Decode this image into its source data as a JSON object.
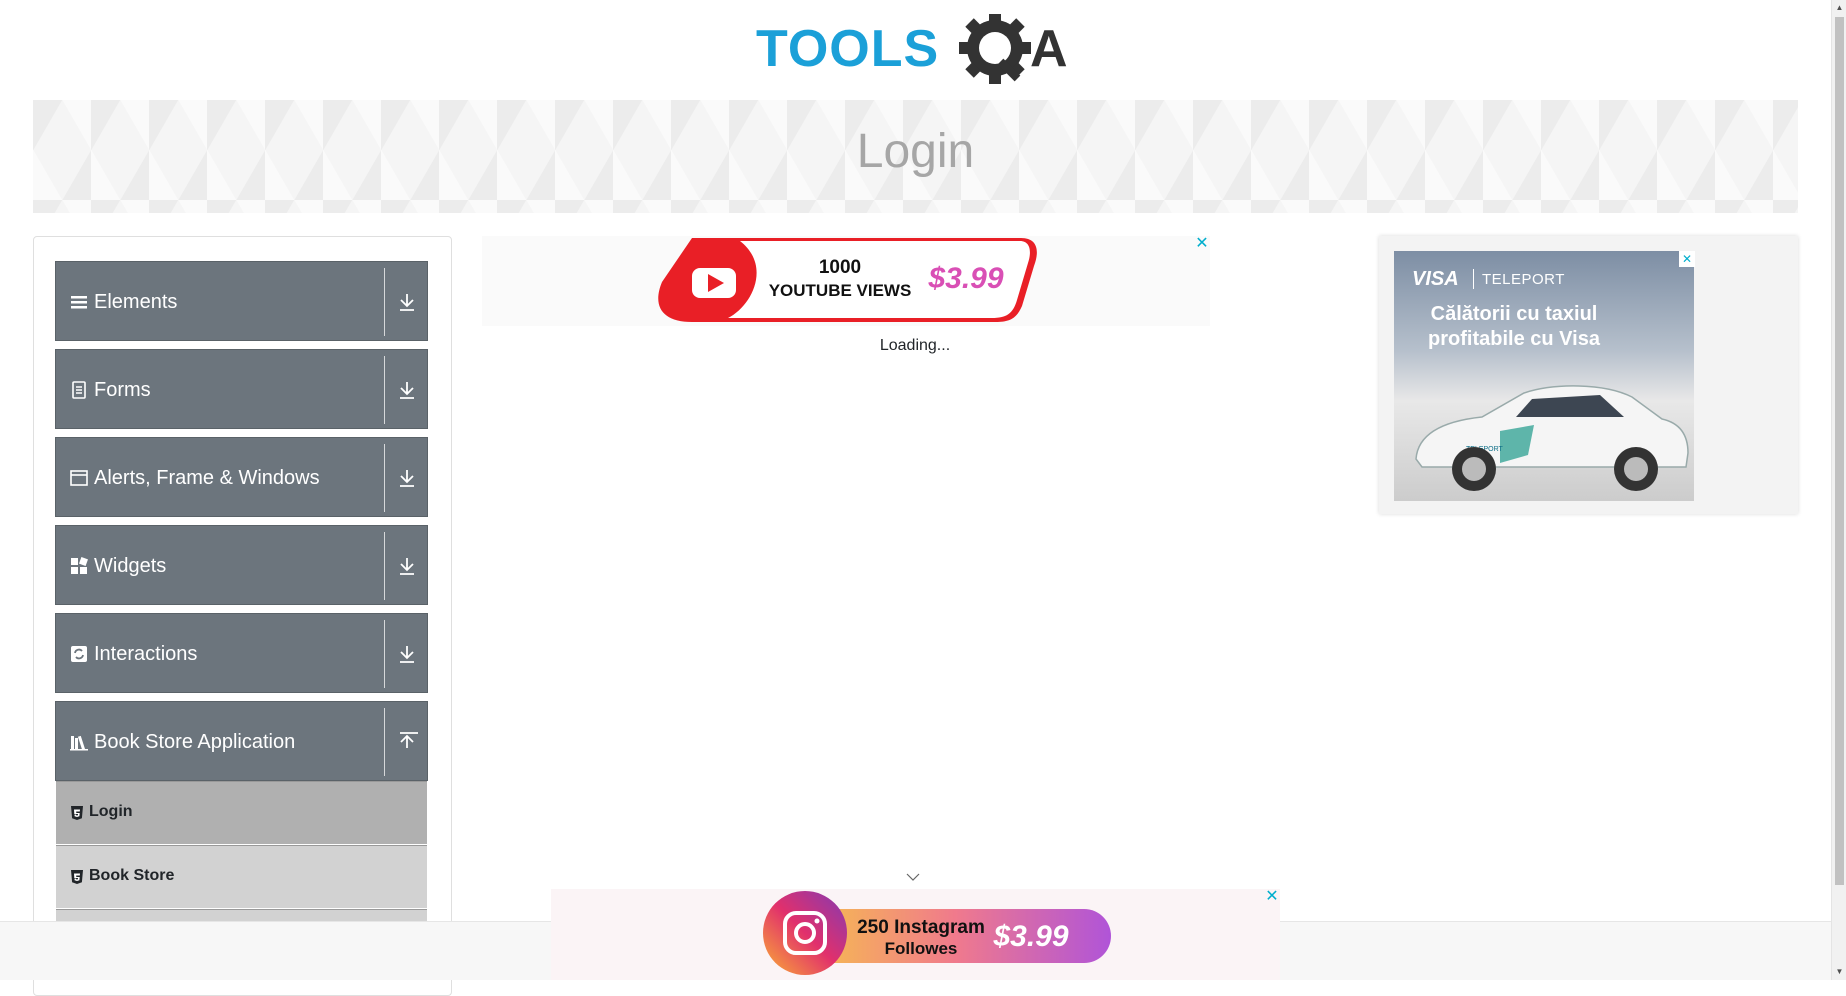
{
  "logo": {
    "text_left": "TOOLS",
    "text_right": "A",
    "color_blue": "#1ba0d8",
    "color_dark": "#333333"
  },
  "page_title": "Login",
  "sidebar": {
    "groups": [
      {
        "label": "Elements",
        "icon": "list-icon",
        "state": "collapsed"
      },
      {
        "label": "Forms",
        "icon": "form-icon",
        "state": "collapsed"
      },
      {
        "label": "Alerts, Frame & Windows",
        "icon": "window-icon",
        "state": "collapsed"
      },
      {
        "label": "Widgets",
        "icon": "widgets-icon",
        "state": "collapsed"
      },
      {
        "label": "Interactions",
        "icon": "interactions-icon",
        "state": "collapsed"
      },
      {
        "label": "Book Store Application",
        "icon": "books-icon",
        "state": "expanded"
      }
    ],
    "book_store_items": [
      {
        "label": "Login",
        "icon": "html5-icon",
        "active": true
      },
      {
        "label": "Book Store",
        "icon": "html5-icon",
        "active": false
      }
    ]
  },
  "ads": {
    "top": {
      "line1": "1000",
      "line2": "YOUTUBE VIEWS",
      "price": "$3.99",
      "close": "✕"
    },
    "right": {
      "brand_left": "VISA",
      "brand_right": "TELEPORT",
      "headline_line1": "Călătorii cu taxiul",
      "headline_line2": "profitabile cu Visa",
      "car_label": "TELEPORT",
      "close": "✕"
    },
    "bottom": {
      "line1": "250 Instagram",
      "line2": "Followes",
      "price": "$3.99",
      "close": "✕"
    }
  },
  "status": {
    "loading": "Loading..."
  },
  "colors": {
    "group_bg": "#6c757d",
    "active_item_bg": "#b0b0b0",
    "item_bg": "#d2d2d2",
    "accent_close": "#00aecd"
  }
}
